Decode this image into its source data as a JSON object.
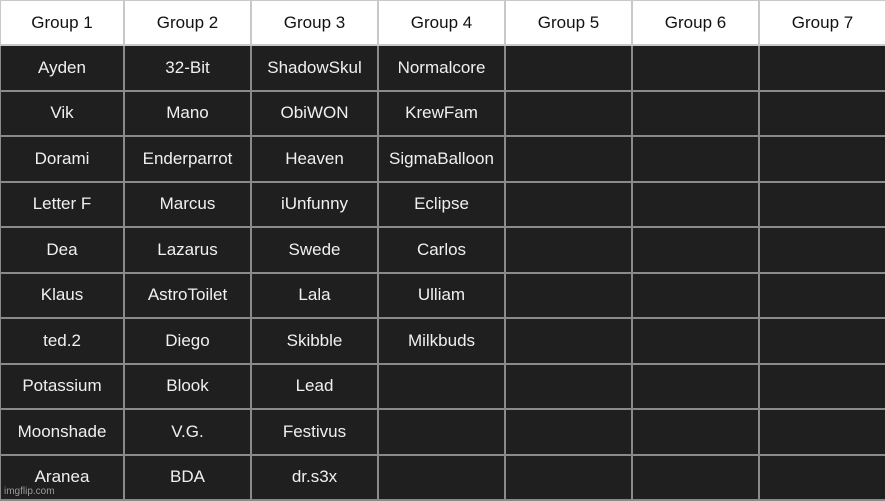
{
  "table": {
    "headers": [
      "Group 1",
      "Group 2",
      "Group 3",
      "Group 4",
      "Group 5",
      "Group 6",
      "Group 7"
    ],
    "rows": [
      [
        "Ayden",
        "32-Bit",
        "ShadowSkul",
        "Normalcore",
        "",
        "",
        ""
      ],
      [
        "Vik",
        "Mano",
        "ObiWON",
        "KrewFam",
        "",
        "",
        ""
      ],
      [
        "Dorami",
        "Enderparrot",
        "Heaven",
        "SigmaBalloon",
        "",
        "",
        ""
      ],
      [
        "Letter F",
        "Marcus",
        "iUnfunny",
        "Eclipse",
        "",
        "",
        ""
      ],
      [
        "Dea",
        "Lazarus",
        "Swede",
        "Carlos",
        "",
        "",
        ""
      ],
      [
        "Klaus",
        "AstroToilet",
        "Lala",
        "Ulliam",
        "",
        "",
        ""
      ],
      [
        "ted.2",
        "Diego",
        "Skibble",
        "Milkbuds",
        "",
        "",
        ""
      ],
      [
        "Potassium",
        "Blook",
        "Lead",
        "",
        "",
        "",
        ""
      ],
      [
        "Moonshade",
        "V.G.",
        "Festivus",
        "",
        "",
        "",
        ""
      ],
      [
        "Aranea",
        "BDA",
        "dr.s3x",
        "",
        "",
        "",
        ""
      ]
    ]
  },
  "watermark": "imgflip.com",
  "colors": {
    "header_bg": "#ffffff",
    "body_bg": "#1f1f1f",
    "grid": "#8a8a8a"
  }
}
